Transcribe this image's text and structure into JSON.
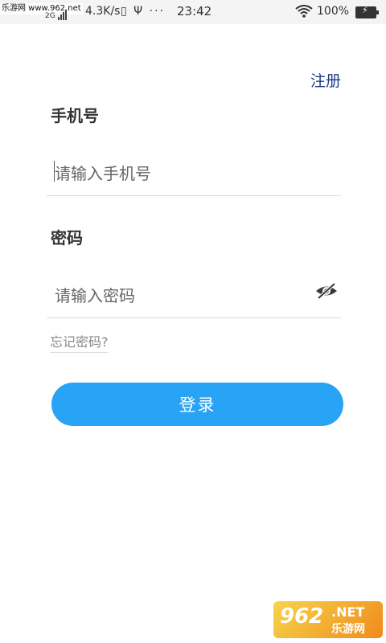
{
  "status_bar": {
    "watermark": "乐游网 www.962.net",
    "network_type": "2G",
    "speed": "4.3K/s",
    "icons": "▯ Ψ ···",
    "time": "23:42",
    "battery": "100%"
  },
  "header": {
    "register_label": "注册"
  },
  "form": {
    "phone_label": "手机号",
    "phone_placeholder": "请输入手机号",
    "password_label": "密码",
    "password_placeholder": "请输入密码",
    "forgot_label": "忘记密码?",
    "login_label": "登录"
  },
  "watermark": {
    "number": "962",
    "net": ".NET",
    "site": "乐游网"
  },
  "colors": {
    "accent": "#29a3f5",
    "register": "#1f3a8a"
  }
}
